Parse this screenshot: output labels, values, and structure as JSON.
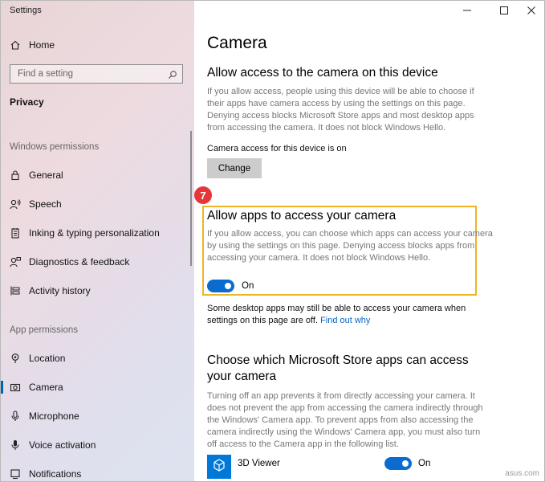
{
  "window": {
    "title": "Settings"
  },
  "sidebar": {
    "home": "Home",
    "search_placeholder": "Find a setting",
    "current_section": "Privacy",
    "windows_permissions_header": "Windows permissions",
    "windows_permissions": [
      {
        "label": "General",
        "icon": "lock-icon"
      },
      {
        "label": "Speech",
        "icon": "speech-icon"
      },
      {
        "label": "Inking & typing personalization",
        "icon": "notepad-icon"
      },
      {
        "label": "Diagnostics & feedback",
        "icon": "feedback-icon"
      },
      {
        "label": "Activity history",
        "icon": "timeline-icon"
      }
    ],
    "app_permissions_header": "App permissions",
    "app_permissions": [
      {
        "label": "Location",
        "icon": "location-icon"
      },
      {
        "label": "Camera",
        "icon": "camera-icon",
        "active": true
      },
      {
        "label": "Microphone",
        "icon": "microphone-icon"
      },
      {
        "label": "Voice activation",
        "icon": "voice-icon"
      },
      {
        "label": "Notifications",
        "icon": "bell-icon"
      }
    ]
  },
  "main": {
    "title": "Camera",
    "device_section": {
      "heading": "Allow access to the camera on this device",
      "description_lines": [
        "If you allow access, people using this device will be able to choose if",
        "their apps have camera access by using the settings on this page.",
        "Denying access blocks Microsoft Store apps and most desktop apps",
        "from accessing the camera. It does not block Windows Hello."
      ],
      "status": "Camera access for this device is on",
      "button": "Change"
    },
    "step_badge": "7",
    "apps_section": {
      "heading": "Allow apps to access your camera",
      "description_lines": [
        "If you allow access, you can choose which apps can access your camera",
        "by using the settings on this page. Denying access blocks apps from",
        "accessing your camera. It does not block Windows Hello."
      ],
      "toggle_state": "On",
      "note_line1": "Some desktop apps may still be able to access your camera when",
      "note_line2_prefix": "settings on this page are off.",
      "note_link": "Find out why"
    },
    "store_section": {
      "heading_line1": "Choose which Microsoft Store apps can access",
      "heading_line2": "your camera",
      "description_lines": [
        "Turning off an app prevents it from directly accessing your camera. It",
        "does not prevent the app from accessing the camera indirectly through",
        "the Windows' Camera app. To prevent apps from also accessing the",
        "camera indirectly using the Windows' Camera app, you must also turn",
        "off access to the Camera app in the following list."
      ],
      "apps": [
        {
          "name": "3D Viewer",
          "state": "On",
          "icon": "cube-icon"
        }
      ]
    }
  },
  "watermark": "asus.com",
  "colors": {
    "accent": "#0a6cd1",
    "highlight_border": "#f0b323",
    "badge": "#e5373a",
    "link": "#0a63c4"
  }
}
